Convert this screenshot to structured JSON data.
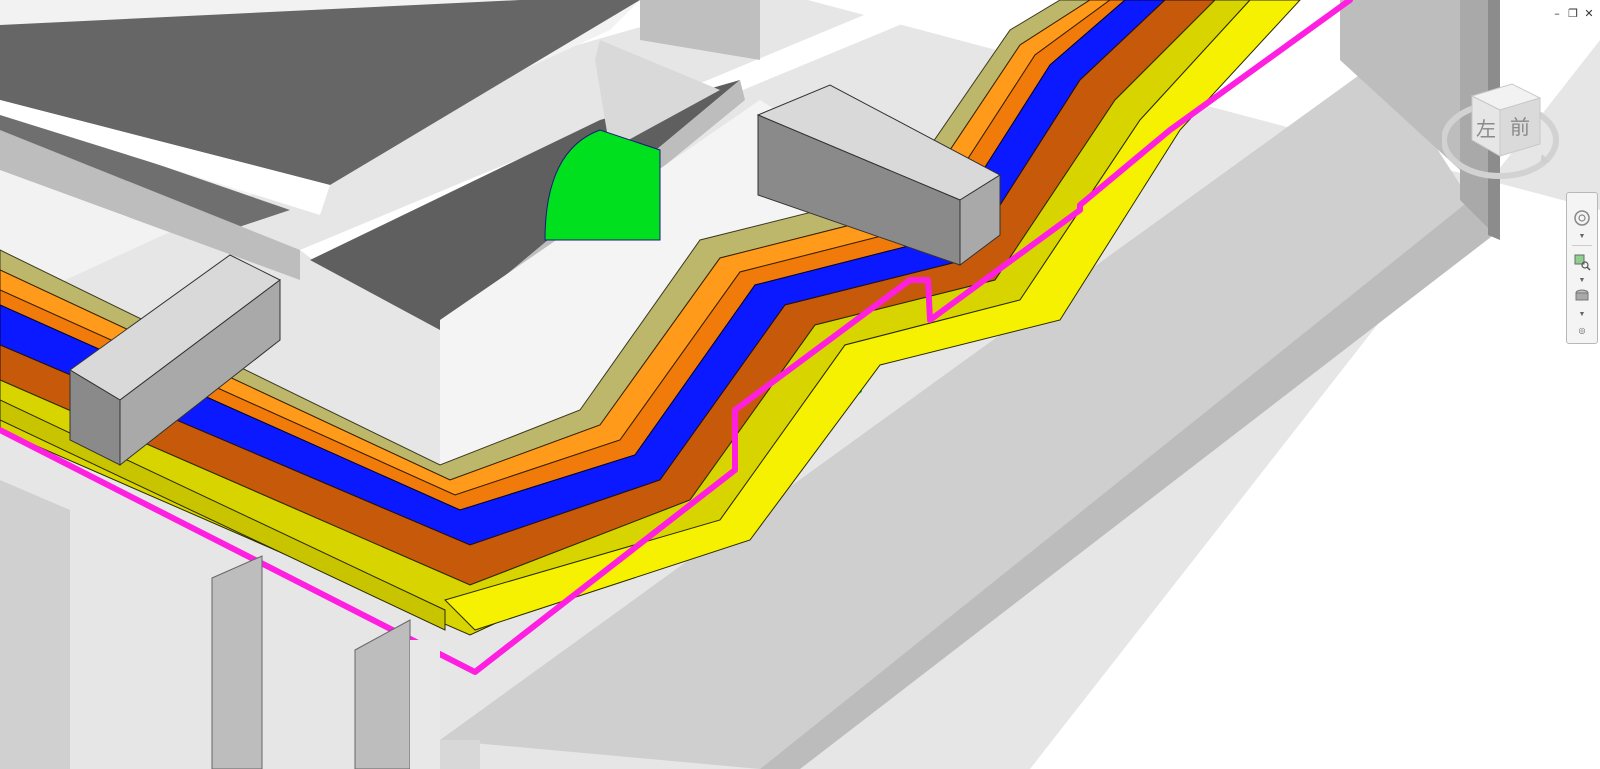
{
  "window": {
    "controls": [
      {
        "name": "minimize",
        "glyph": "–"
      },
      {
        "name": "restore",
        "glyph": "❐"
      },
      {
        "name": "close",
        "glyph": "✕"
      }
    ]
  },
  "viewcube": {
    "faces": {
      "left": "左",
      "front": "前"
    },
    "icon": "viewcube-icon"
  },
  "navigation_bar": {
    "tools": [
      {
        "name": "steering-wheel-icon",
        "has_dropdown": true
      },
      {
        "name": "zoom-region-icon",
        "has_dropdown": true
      },
      {
        "name": "orbit-icon",
        "has_dropdown": true
      }
    ]
  },
  "colors": {
    "background": "#ffffff",
    "structure_light": "#d6d6d6",
    "structure_mid": "#bdbdbd",
    "structure_dark": "#6b6b6b",
    "cable_tray_khaki": "#bdb76b",
    "cable_tray_orange": "#ff9a1a",
    "cable_tray_blue": "#0a19ff",
    "cable_tray_brown": "#c65a0a",
    "cable_tray_yellow": "#f5f100",
    "cable_tray_olive_yellow": "#d8d400",
    "pipe_magenta": "#ff1fe0",
    "equipment_green": "#00e01e"
  }
}
